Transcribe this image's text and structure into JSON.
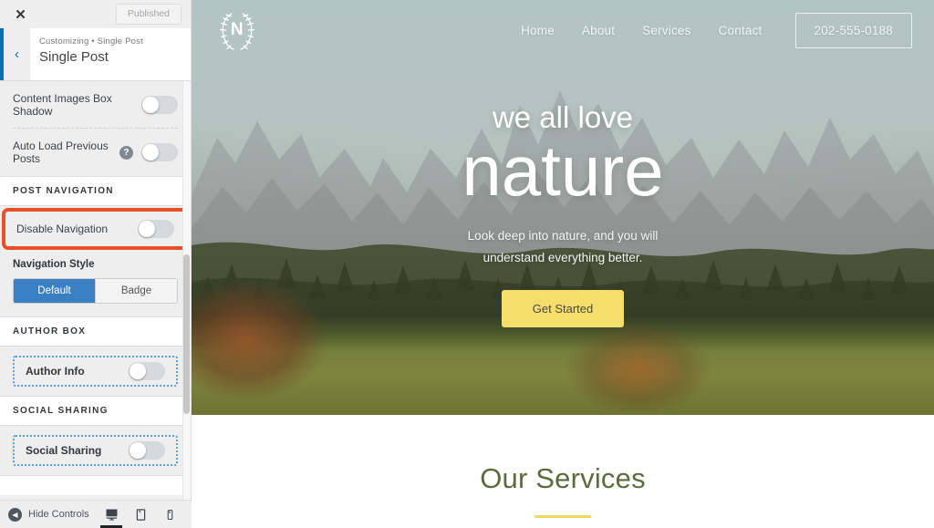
{
  "customizer": {
    "close_label": "✕",
    "publish_label": "Published",
    "back_label": "‹",
    "breadcrumb": "Customizing • Single Post",
    "panel_title": "Single Post",
    "rows": {
      "content_images_box_shadow": "Content Images Box Shadow",
      "auto_load_previous_posts": "Auto Load Previous Posts",
      "help_glyph": "?",
      "disable_navigation": "Disable Navigation",
      "author_info": "Author Info",
      "social_sharing_toggle": "Social Sharing"
    },
    "sections": {
      "post_navigation": "POST NAVIGATION",
      "author_box": "AUTHOR BOX",
      "social_sharing": "SOCIAL SHARING"
    },
    "navigation_style": {
      "label": "Navigation Style",
      "options": [
        "Default",
        "Badge"
      ],
      "selected": "Default"
    },
    "footer": {
      "hide_controls": "Hide Controls",
      "devices": [
        "desktop",
        "tablet",
        "mobile"
      ],
      "active_device": "desktop"
    },
    "colors": {
      "highlight": "#e8502a",
      "accent_blue": "#3a7fc4",
      "dotted_blue": "#55a0e0"
    }
  },
  "site": {
    "logo": {
      "letter": "N",
      "icon": "laurel-wreath-icon"
    },
    "nav": [
      {
        "label": "Home"
      },
      {
        "label": "About"
      },
      {
        "label": "Services"
      },
      {
        "label": "Contact"
      }
    ],
    "phone": "202-555-0188",
    "hero": {
      "eyebrow": "we all love",
      "headline": "nature",
      "subtext_line1": "Look deep into nature, and you will",
      "subtext_line2": "understand everything better.",
      "cta_label": "Get Started"
    },
    "services": {
      "title": "Our Services",
      "rule_color": "#f0d95f",
      "title_color": "#5b6b3c"
    }
  }
}
